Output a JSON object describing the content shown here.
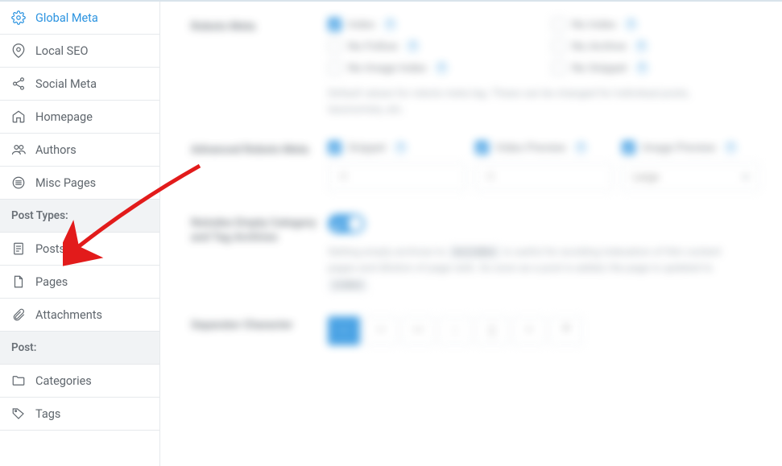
{
  "colors": {
    "accent": "#2b93e0",
    "arrow": "#e21b1b"
  },
  "sidebar": {
    "items": [
      {
        "label": "Global Meta",
        "icon": "gear-icon",
        "active": true
      },
      {
        "label": "Local SEO",
        "icon": "pin-icon"
      },
      {
        "label": "Social Meta",
        "icon": "share-icon"
      },
      {
        "label": "Homepage",
        "icon": "home-icon"
      },
      {
        "label": "Authors",
        "icon": "users-icon"
      },
      {
        "label": "Misc Pages",
        "icon": "list-icon"
      }
    ],
    "section1": "Post Types:",
    "post_types": [
      {
        "label": "Posts",
        "icon": "document-icon"
      },
      {
        "label": "Pages",
        "icon": "page-icon"
      },
      {
        "label": "Attachments",
        "icon": "paperclip-icon"
      }
    ],
    "section2": "Post:",
    "post": [
      {
        "label": "Categories",
        "icon": "folder-icon"
      },
      {
        "label": "Tags",
        "icon": "tag-icon"
      }
    ]
  },
  "main": {
    "robots": {
      "title": "Robots Meta",
      "options": [
        {
          "label": "Index",
          "checked": true
        },
        {
          "label": "No Index",
          "checked": false
        },
        {
          "label": "No Follow",
          "checked": false
        },
        {
          "label": "No Archive",
          "checked": false
        },
        {
          "label": "No Image Index",
          "checked": false
        },
        {
          "label": "No Snippet",
          "checked": false
        }
      ],
      "desc": "Default values for robots meta tag. These can be changed for individual posts, taxonomies, etc."
    },
    "advanced": {
      "title": "Advanced Robots Meta",
      "cols": [
        {
          "label": "Snippet",
          "value": "-1"
        },
        {
          "label": "Video Preview",
          "value": "-1"
        },
        {
          "label": "Image Preview",
          "value": "Large",
          "select": true
        }
      ]
    },
    "noindex": {
      "title": "Noindex Empty Category and Tag Archives",
      "desc_parts": {
        "a": "Setting empty archives to ",
        "code1": "noindex",
        "b": " is useful for avoiding indexation of thin content pages and dilution of page rank. As soon as a post is added, the page is updated to ",
        "code2": "index",
        "c": "."
      }
    },
    "separator": {
      "title": "Separator Character",
      "options": [
        "-",
        "–",
        "—",
        ":",
        "|",
        "•",
        "*"
      ]
    }
  }
}
